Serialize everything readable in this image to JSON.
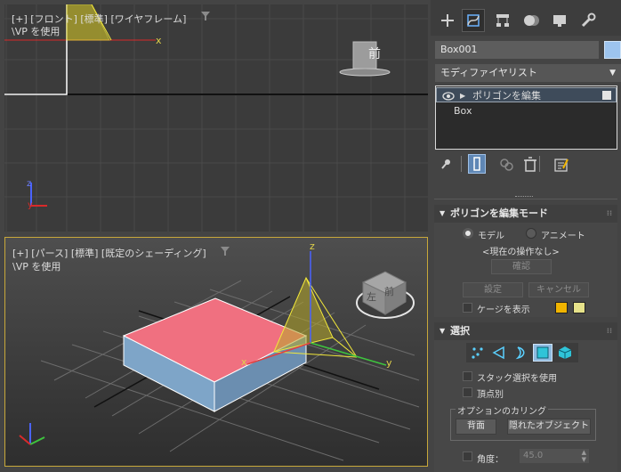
{
  "viewport_front": {
    "label": "[+] [フロント] [標準] [ワイヤフレーム]",
    "sublabel": "\\VP を使用",
    "viewcube_face": "前",
    "axis_x": "x",
    "axis_y": "y",
    "axis_z": "z"
  },
  "viewport_persp": {
    "label": "[+] [パース] [標準] [既定のシェーディング]",
    "sublabel": "\\VP を使用",
    "viewcube_face": "前",
    "viewcube_face2": "左",
    "axis_x": "x",
    "axis_y": "y",
    "axis_z": "z"
  },
  "command_panel": {
    "tabs": [
      "create",
      "modify",
      "hierarchy",
      "motion",
      "display",
      "utilities"
    ],
    "object_name": "Box001",
    "object_color": "#9dc4ee",
    "modifier_list": "モディファイヤリスト",
    "stack": {
      "items": [
        "ポリゴンを編集",
        "Box"
      ]
    }
  },
  "rollout_edit_mode": {
    "title": "ポリゴンを編集モード",
    "radio_model": "モデル",
    "radio_animate": "アニメート",
    "current_op": "<現在の操作なし>",
    "confirm": "確認",
    "settings": "設定",
    "cancel": "キャンセル",
    "show_cage": "ケージを表示",
    "cage_color_1": "#f0b400",
    "cage_color_2": "#e6e28a"
  },
  "rollout_selection": {
    "title": "選択",
    "use_stack_selection": "スタック選択を使用",
    "by_vertex": "頂点別",
    "culling_group": "オプションのカリング",
    "backface": "背面",
    "occluded": "隠れたオブジェクト",
    "angle_label": "角度：",
    "angle_value": "45.0"
  }
}
